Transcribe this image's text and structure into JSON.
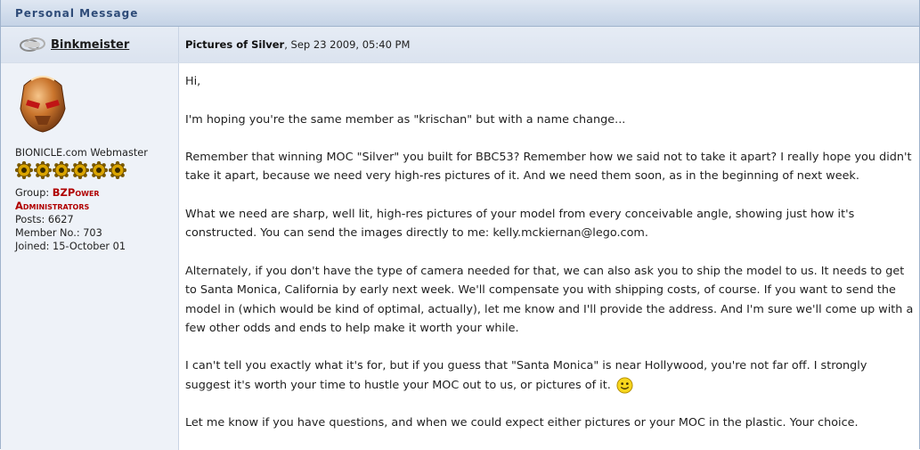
{
  "window": {
    "title": "Personal Message"
  },
  "author": {
    "name": "Binkmeister",
    "title": "BIONICLE.com Webmaster",
    "pip_count": 6,
    "group_label": "Group:",
    "group_name_line1": "BZPower",
    "group_name_line2": "Administrators",
    "posts": "Posts: 6627",
    "member_no": "Member No.: 703",
    "joined": "Joined: 15-October 01"
  },
  "message": {
    "subject": "Pictures of Silver",
    "date": ", Sep 23 2009, 05:40 PM",
    "paragraphs": [
      "Hi,",
      "I'm hoping you're the same member as \"krischan\" but with a name change...",
      "Remember that winning MOC \"Silver\" you built for BBC53? Remember how we said not to take it apart? I really hope you didn't take it apart, because we need very high-res pictures of it. And we need them soon, as in the beginning of next week.",
      "What we need are sharp, well lit, high-res pictures of your model from every conceivable angle, showing just how it's constructed. You can send the images directly to me: kelly.mckiernan@lego.com.",
      "Alternately, if you don't have the type of camera needed for that, we can also ask you to ship the model to us. It needs to get to Santa Monica, California by early next week. We'll compensate you with shipping costs, of course. If you want to send the model in (which would be kind of optimal, actually), let me know and I'll provide the address. And I'm sure we'll come up with a few other odds and ends to help make it worth your while.",
      "I can't tell you exactly what it's for, but if you guess that \"Santa Monica\" is near Hollywood, you're not far off. I strongly suggest it's worth your time to hustle your MOC out to us, or pictures of it.",
      "Let me know if you have questions, and when we could expect either pictures or your MOC in the plastic. Your choice."
    ]
  },
  "icons": {
    "status": "offline-status-icon",
    "smiley": "smiley-icon",
    "pip": "gear-pip-icon"
  }
}
